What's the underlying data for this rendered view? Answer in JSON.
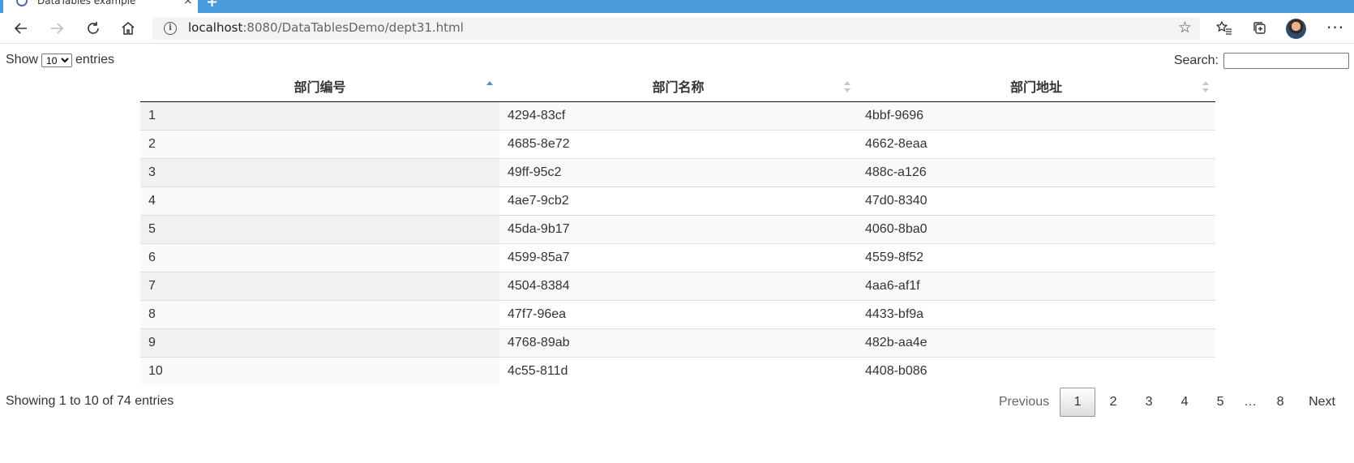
{
  "browser": {
    "tab_title": "DataTables example",
    "url_host": "localhost",
    "url_rest": ":8080/DataTablesDemo/dept31.html"
  },
  "length_menu": {
    "prefix": "Show",
    "selected": "10",
    "suffix": "entries"
  },
  "search": {
    "label": "Search:",
    "value": ""
  },
  "table": {
    "columns": [
      "部门编号",
      "部门名称",
      "部门地址"
    ],
    "rows": [
      [
        "1",
        "4294-83cf",
        "4bbf-9696"
      ],
      [
        "2",
        "4685-8e72",
        "4662-8eaa"
      ],
      [
        "3",
        "49ff-95c2",
        "488c-a126"
      ],
      [
        "4",
        "4ae7-9cb2",
        "47d0-8340"
      ],
      [
        "5",
        "45da-9b17",
        "4060-8ba0"
      ],
      [
        "6",
        "4599-85a7",
        "4559-8f52"
      ],
      [
        "7",
        "4504-8384",
        "4aa6-af1f"
      ],
      [
        "8",
        "47f7-96ea",
        "4433-bf9a"
      ],
      [
        "9",
        "4768-89ab",
        "482b-aa4e"
      ],
      [
        "10",
        "4c55-811d",
        "4408-b086"
      ]
    ]
  },
  "info": "Showing 1 to 10 of 74 entries",
  "pagination": {
    "previous": "Previous",
    "pages": [
      "1",
      "2",
      "3",
      "4",
      "5"
    ],
    "ellipsis": "…",
    "last": "8",
    "next": "Next"
  }
}
